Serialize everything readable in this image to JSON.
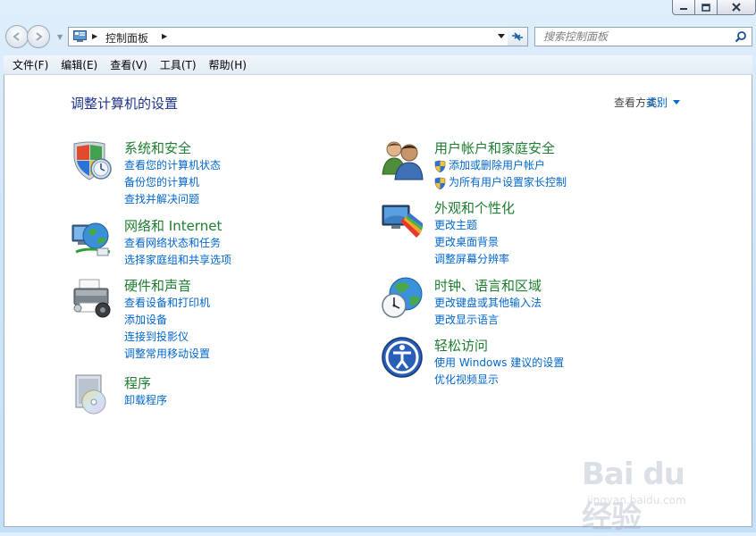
{
  "window": {
    "minimize": "",
    "maximize": "",
    "close": ""
  },
  "nav": {
    "breadcrumb": "控制面板",
    "search_placeholder": "搜索控制面板"
  },
  "menu": [
    {
      "label": "文件(F)"
    },
    {
      "label": "编辑(E)"
    },
    {
      "label": "查看(V)"
    },
    {
      "label": "工具(T)"
    },
    {
      "label": "帮助(H)"
    }
  ],
  "content": {
    "title": "调整计算机的设置",
    "view_by_label": "查看方式:",
    "view_by_value": "类别"
  },
  "categories": [
    {
      "title": "系统和安全",
      "icon": "system-security-icon",
      "links": [
        "查看您的计算机状态",
        "备份您的计算机",
        "查找并解决问题"
      ]
    },
    {
      "title": "网络和 Internet",
      "icon": "network-icon",
      "links": [
        "查看网络状态和任务",
        "选择家庭组和共享选项"
      ]
    },
    {
      "title": "硬件和声音",
      "icon": "hardware-printer-icon",
      "links": [
        "查看设备和打印机",
        "添加设备",
        "连接到投影仪",
        "调整常用移动设置"
      ]
    },
    {
      "title": "程序",
      "icon": "programs-icon",
      "links": [
        "卸载程序"
      ]
    },
    {
      "title": "用户帐户和家庭安全",
      "icon": "user-accounts-icon",
      "links": [
        "添加或删除用户帐户",
        "为所有用户设置家长控制"
      ]
    },
    {
      "title": "外观和个性化",
      "icon": "appearance-icon",
      "links": [
        "更改主题",
        "更改桌面背景",
        "调整屏幕分辨率"
      ]
    },
    {
      "title": "时钟、语言和区域",
      "icon": "clock-globe-icon",
      "links": [
        "更改键盘或其他输入法",
        "更改显示语言"
      ]
    },
    {
      "title": "轻松访问",
      "icon": "ease-of-access-icon",
      "links": [
        "使用 Windows 建议的设置",
        "优化视频显示"
      ]
    }
  ],
  "watermark": {
    "logo": "Bai du 经验",
    "url": "jingyan.baidu.com"
  }
}
